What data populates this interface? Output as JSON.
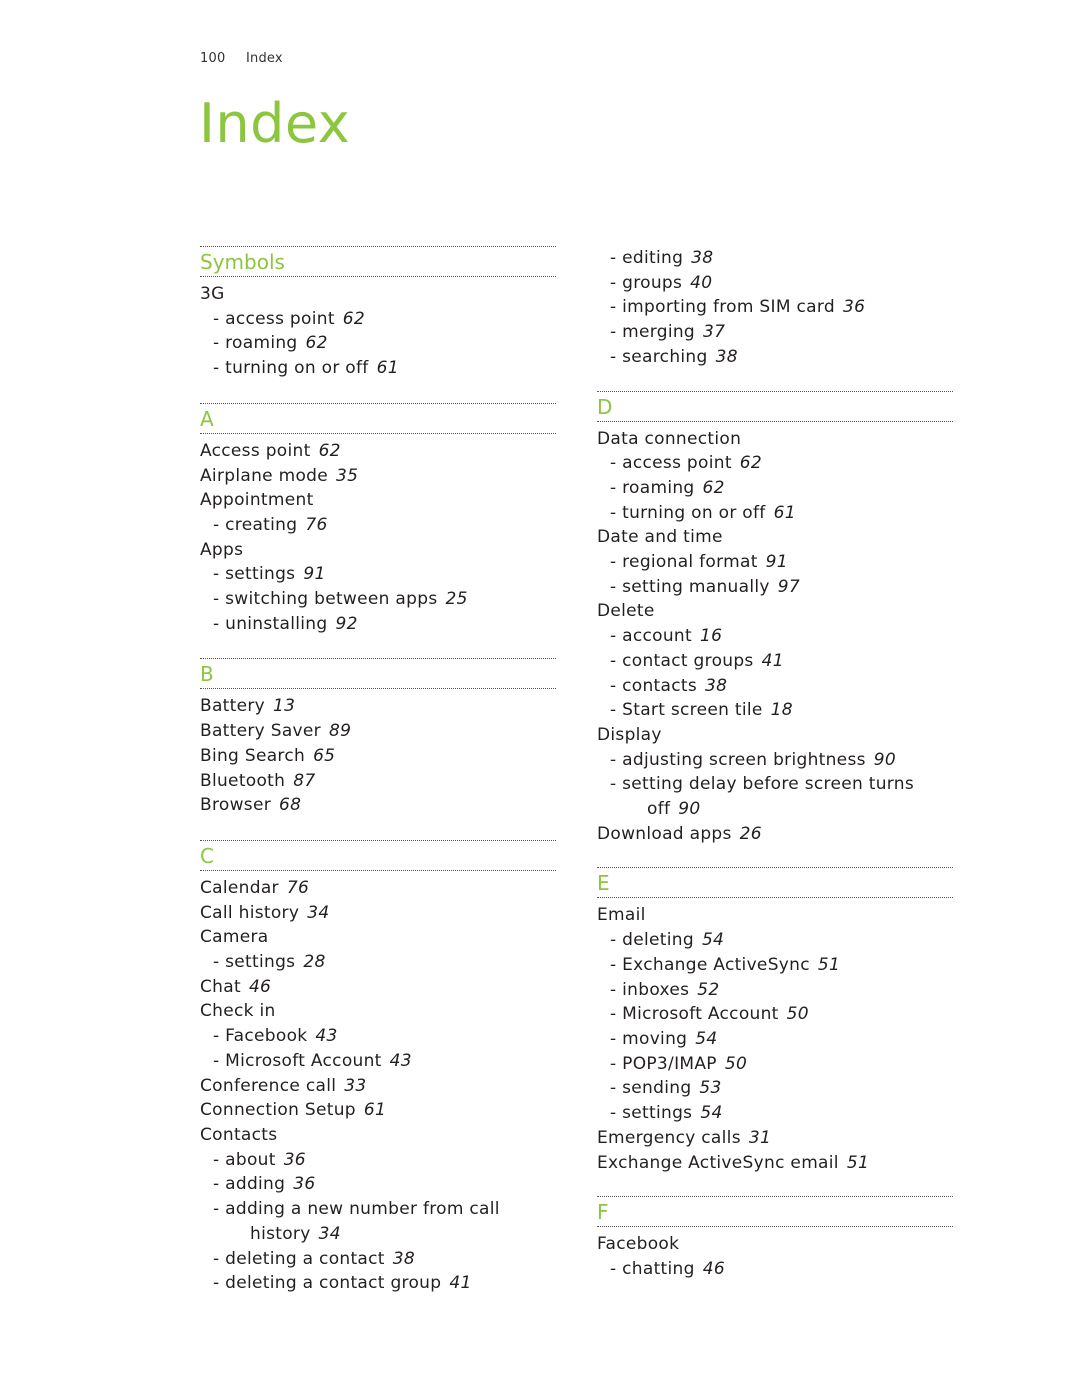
{
  "header": {
    "page_number": "100",
    "section": "Index"
  },
  "title": "Index",
  "accent_color": "#8cc63f",
  "left_column": [
    {
      "heading": "Symbols",
      "entries": [
        {
          "text": "3G",
          "page": "",
          "level": 0
        },
        {
          "text": "- access point",
          "page": "62",
          "level": 1
        },
        {
          "text": "- roaming",
          "page": "62",
          "level": 1
        },
        {
          "text": "- turning on or off",
          "page": "61",
          "level": 1
        }
      ]
    },
    {
      "heading": "A",
      "entries": [
        {
          "text": "Access point",
          "page": "62",
          "level": 0
        },
        {
          "text": "Airplane mode",
          "page": "35",
          "level": 0
        },
        {
          "text": "Appointment",
          "page": "",
          "level": 0
        },
        {
          "text": "- creating",
          "page": "76",
          "level": 1
        },
        {
          "text": "Apps",
          "page": "",
          "level": 0
        },
        {
          "text": "- settings",
          "page": "91",
          "level": 1
        },
        {
          "text": "- switching between apps",
          "page": "25",
          "level": 1
        },
        {
          "text": "- uninstalling",
          "page": "92",
          "level": 1
        }
      ]
    },
    {
      "heading": "B",
      "entries": [
        {
          "text": "Battery",
          "page": "13",
          "level": 0
        },
        {
          "text": "Battery Saver",
          "page": "89",
          "level": 0
        },
        {
          "text": "Bing Search",
          "page": "65",
          "level": 0
        },
        {
          "text": "Bluetooth",
          "page": "87",
          "level": 0
        },
        {
          "text": "Browser",
          "page": "68",
          "level": 0
        }
      ]
    },
    {
      "heading": "C",
      "entries": [
        {
          "text": "Calendar",
          "page": "76",
          "level": 0
        },
        {
          "text": "Call history",
          "page": "34",
          "level": 0
        },
        {
          "text": "Camera",
          "page": "",
          "level": 0
        },
        {
          "text": "- settings",
          "page": "28",
          "level": 1
        },
        {
          "text": "Chat",
          "page": "46",
          "level": 0
        },
        {
          "text": "Check in",
          "page": "",
          "level": 0
        },
        {
          "text": "- Facebook",
          "page": "43",
          "level": 1
        },
        {
          "text": "- Microsoft Account",
          "page": "43",
          "level": 1
        },
        {
          "text": "Conference call",
          "page": "33",
          "level": 0
        },
        {
          "text": "Connection Setup",
          "page": "61",
          "level": 0
        },
        {
          "text": "Contacts",
          "page": "",
          "level": 0
        },
        {
          "text": "- about",
          "page": "36",
          "level": 1
        },
        {
          "text": "- adding",
          "page": "36",
          "level": 1
        },
        {
          "text": "- adding a new number from call",
          "continuation": "history",
          "page": "34",
          "level": 1
        },
        {
          "text": "- deleting a contact",
          "page": "38",
          "level": 1
        },
        {
          "text": "- deleting a contact group",
          "page": "41",
          "level": 1
        }
      ]
    }
  ],
  "right_column": [
    {
      "heading": "",
      "entries": [
        {
          "text": "- editing",
          "page": "38",
          "level": 1
        },
        {
          "text": "- groups",
          "page": "40",
          "level": 1
        },
        {
          "text": "- importing from SIM card",
          "page": "36",
          "level": 1
        },
        {
          "text": "- merging",
          "page": "37",
          "level": 1
        },
        {
          "text": "- searching",
          "page": "38",
          "level": 1
        }
      ]
    },
    {
      "heading": "D",
      "entries": [
        {
          "text": "Data connection",
          "page": "",
          "level": 0
        },
        {
          "text": "- access point",
          "page": "62",
          "level": 1
        },
        {
          "text": "- roaming",
          "page": "62",
          "level": 1
        },
        {
          "text": "- turning on or off",
          "page": "61",
          "level": 1
        },
        {
          "text": "Date and time",
          "page": "",
          "level": 0
        },
        {
          "text": "- regional format",
          "page": "91",
          "level": 1
        },
        {
          "text": "- setting manually",
          "page": "97",
          "level": 1
        },
        {
          "text": "Delete",
          "page": "",
          "level": 0
        },
        {
          "text": "- account",
          "page": "16",
          "level": 1
        },
        {
          "text": "- contact groups",
          "page": "41",
          "level": 1
        },
        {
          "text": "- contacts",
          "page": "38",
          "level": 1
        },
        {
          "text": "- Start screen tile",
          "page": "18",
          "level": 1
        },
        {
          "text": "Display",
          "page": "",
          "level": 0
        },
        {
          "text": "- adjusting screen brightness",
          "page": "90",
          "level": 1
        },
        {
          "text": "- setting delay before screen turns",
          "continuation": "off",
          "page": "90",
          "level": 1
        },
        {
          "text": "Download apps",
          "page": "26",
          "level": 0
        }
      ]
    },
    {
      "heading": "E",
      "entries": [
        {
          "text": "Email",
          "page": "",
          "level": 0
        },
        {
          "text": "- deleting",
          "page": "54",
          "level": 1
        },
        {
          "text": "- Exchange ActiveSync",
          "page": "51",
          "level": 1
        },
        {
          "text": "- inboxes",
          "page": "52",
          "level": 1
        },
        {
          "text": "- Microsoft Account",
          "page": "50",
          "level": 1
        },
        {
          "text": "- moving",
          "page": "54",
          "level": 1
        },
        {
          "text": "- POP3/IMAP",
          "page": "50",
          "level": 1
        },
        {
          "text": "- sending",
          "page": "53",
          "level": 1
        },
        {
          "text": "- settings",
          "page": "54",
          "level": 1
        },
        {
          "text": "Emergency calls",
          "page": "31",
          "level": 0
        },
        {
          "text": "Exchange ActiveSync email",
          "page": "51",
          "level": 0
        }
      ]
    },
    {
      "heading": "F",
      "entries": [
        {
          "text": "Facebook",
          "page": "",
          "level": 0
        },
        {
          "text": "- chatting",
          "page": "46",
          "level": 1
        }
      ]
    }
  ]
}
